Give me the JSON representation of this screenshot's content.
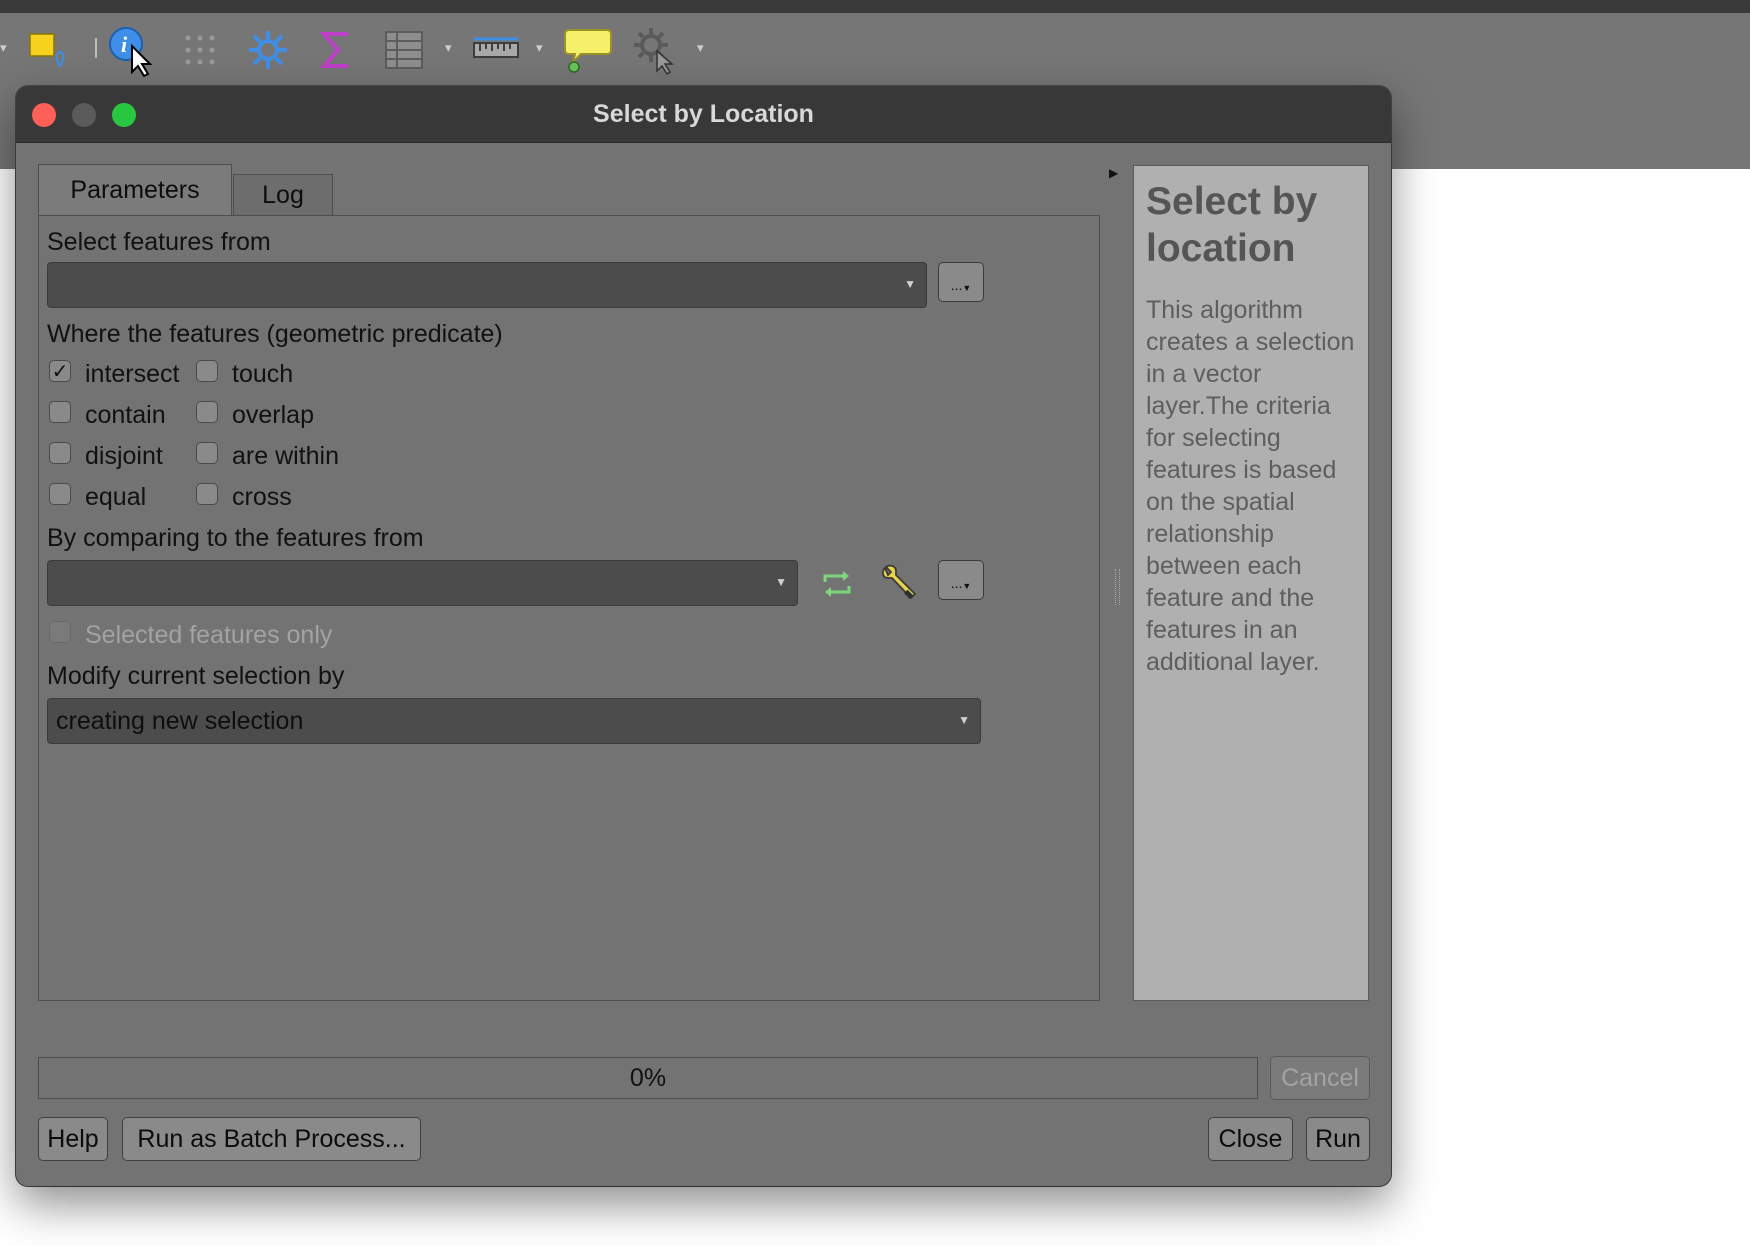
{
  "toolbar": {
    "icons": [
      "select-features-icon",
      "identify-features-icon",
      "attribute-table-icon",
      "processing-settings-icon",
      "statistics-icon",
      "open-table-icon",
      "measure-icon",
      "map-tips-icon",
      "action-icon"
    ]
  },
  "dialog": {
    "title": "Select by Location",
    "tabs": [
      "Parameters",
      "Log"
    ],
    "active_tab": "Parameters",
    "select_from_label": "Select features from",
    "select_from_value": "",
    "select_from_button": "...",
    "predicate_label": "Where the features (geometric predicate)",
    "predicates": [
      {
        "label": "intersect",
        "checked": true
      },
      {
        "label": "touch",
        "checked": false
      },
      {
        "label": "contain",
        "checked": false
      },
      {
        "label": "overlap",
        "checked": false
      },
      {
        "label": "disjoint",
        "checked": false
      },
      {
        "label": "are within",
        "checked": false
      },
      {
        "label": "equal",
        "checked": false
      },
      {
        "label": "cross",
        "checked": false
      }
    ],
    "compare_label": "By comparing to the features from",
    "compare_value": "",
    "compare_button": "...",
    "selected_only_label": "Selected features only",
    "selected_only_checked": false,
    "modify_label": "Modify current selection by",
    "modify_value": "creating new selection",
    "help_title": "Select by location",
    "help_text": "This algorithm creates a selection in a vector layer.The criteria for selecting features is based on the spatial relationship between each feature and the features in an additional layer.",
    "progress_text": "0%",
    "progress_fraction": 0,
    "buttons": {
      "cancel": "Cancel",
      "help": "Help",
      "batch": "Run as Batch Process...",
      "close": "Close",
      "run": "Run"
    }
  },
  "colors": {
    "close": "#fe5f57",
    "minimize": "#5b5b5b",
    "zoom": "#27c840",
    "refresh": "#7dd67b",
    "sigma": "#c03fc9",
    "gear": "#3f8fe8",
    "select_yellow": "#f6d21e"
  }
}
